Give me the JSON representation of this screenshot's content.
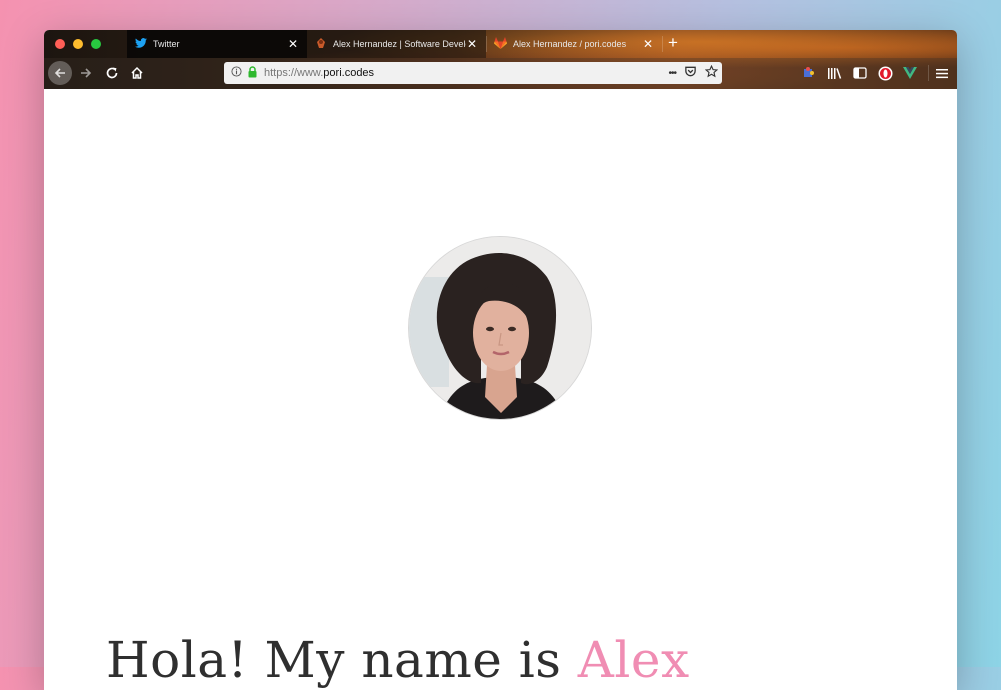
{
  "browser": {
    "tabs": [
      {
        "title": "Twitter",
        "icon": "twitter-bird-icon",
        "active": false
      },
      {
        "title": "Alex Hernandez | Software Developer",
        "icon": "site-favicon-icon",
        "active": true
      },
      {
        "title": "Alex Hernandez / pori.codes",
        "icon": "gitlab-fox-icon",
        "active": false
      }
    ],
    "new_tab_symbol": "+",
    "url": {
      "prefix": "https://www.",
      "domain": "pori.codes"
    },
    "page_actions_symbol": "•••"
  },
  "page": {
    "headline_prefix": "Hola! My name is ",
    "headline_name": "Alex"
  },
  "colors": {
    "accent_pink": "#f08db3",
    "secure_lock_green": "#2eb82e",
    "twitter_blue": "#1da1f2",
    "gitlab_orange": "#e24329"
  }
}
